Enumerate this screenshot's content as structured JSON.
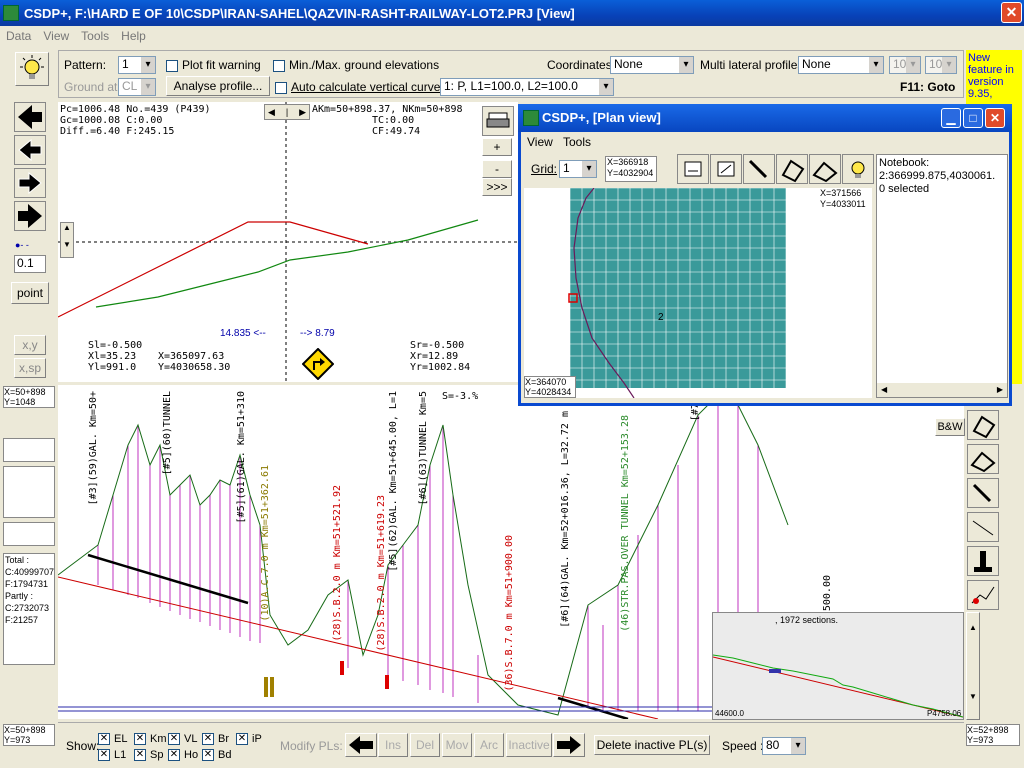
{
  "window": {
    "title": "CSDP+, F:\\HARD E OF 10\\CSDP\\IRAN-SAHEL\\QAZVIN-RASHT-RAILWAY-LOT2.PRJ [View]",
    "close": "✕"
  },
  "menu": [
    "Data",
    "View",
    "Tools",
    "Help"
  ],
  "toolbar": {
    "pattern_label": "Pattern:",
    "pattern_value": "1",
    "plot_fit": "Plot fit warning",
    "minmax": "Min./Max. ground elevations",
    "coords_label": "Coordinates:",
    "coords_value": "None",
    "multi_label": "Multi lateral profiles:",
    "multi_value": "None",
    "num1": "10",
    "num2": "10",
    "ground_label": "Ground at:",
    "ground_value": "CL",
    "analyse": "Analyse profile...",
    "auto_calc": "Auto calculate vertical curves",
    "curve_value": "1: P, L1=100.0, L2=100.0",
    "goto": "F11: Goto"
  },
  "news": "New feature in version 9.35,",
  "left_panel": {
    "zoom_value": "0.1",
    "point_btn": "point",
    "xy_btn": "x,y",
    "xsp_btn": "x,sp",
    "pos_top": "X=50+898",
    "pos_top2": "Y=1048",
    "totals": [
      "Total :",
      "C:40999707",
      "F:1794731",
      "Partly :",
      "C:2732073",
      "F:21257"
    ],
    "pos_bottom": "X=50+898",
    "pos_bottom2": "Y=973"
  },
  "profile_info": {
    "l1": "Pc=1006.48  No.=439 (P439)",
    "l2": "Gc=1000.08       C:0.00",
    "l3": "Diff.=6.40        F:245.15",
    "r1": "AKm=50+898.37, NKm=50+898",
    "r2": "TC:0.00",
    "r3": "CF:49.74",
    "sl": "Sl=-0.500",
    "xl": "Xl=35.23",
    "yl": "Yl=991.0",
    "mx": "X=365097.63",
    "my": "Y=4030658.30",
    "sr": "Sr=-0.500",
    "xr": "Xr=12.89",
    "yr": "Yr=1002.84",
    "dist_l": "14.835 <--",
    "dist_r": "--> 8.79"
  },
  "right_tools": {
    "plus": "+",
    "minus": "-",
    "more": ">>>",
    "bw": "B&W"
  },
  "plan": {
    "title": "CSDP+, [Plan view]",
    "menu": [
      "View",
      "Tools"
    ],
    "grid_label": "Grid:",
    "grid_value": "1",
    "coord_tl": "X=366918",
    "coord_tl2": "Y=4032904",
    "coord_tr": "X=371566",
    "coord_tr2": "Y=4033011",
    "coord_bl": "X=364070",
    "coord_bl2": "Y=4028434",
    "marker": "2",
    "notebook": "Notebook:",
    "nb_value": "2:366999.875,4030061.",
    "nb_sel": "0 selected"
  },
  "long": {
    "slope": "S=-3.%",
    "labels": [
      {
        "t": "[#3](59)GAL. Km=50+",
        "c": "#000"
      },
      {
        "t": "[#5](60)TUNNEL",
        "c": "#000"
      },
      {
        "t": "[#5](61)GAL. Km=51+310",
        "c": "#000"
      },
      {
        "t": "(10)A.C.7.0 m Km=51+362.61",
        "c": "#8a7a00"
      },
      {
        "t": "(28)S.B.2.0 m Km=51+521.92",
        "c": "#c00"
      },
      {
        "t": "(28)S.B.2.0 m Km=51+619.23",
        "c": "#c00"
      },
      {
        "t": "[#5](62)GAL. Km=51+645.00, L=1",
        "c": "#000"
      },
      {
        "t": "[#6](63)TUNNEL Km=5",
        "c": "#000"
      },
      {
        "t": "(36)S.B.7.0 m Km=51+900.00",
        "c": "#c00"
      },
      {
        "t": "[#6](64)GAL. Km=52+016.36, L=32.72 m",
        "c": "#000"
      },
      {
        "t": "(46)STR.PAS.OVER TUNNEL Km=52+153.28",
        "c": "#2a8a2a"
      },
      {
        "t": "[#7](",
        "c": "#000"
      },
      {
        "t": "500.00",
        "c": "#000"
      }
    ]
  },
  "minimap": {
    "sections": ", 1972 sections.",
    "left": "44600.0",
    "right": "P4758.06"
  },
  "pos_right": "X=52+898",
  "pos_right2": "Y=973",
  "bottom": {
    "show": "Show:",
    "checks": [
      "EL",
      "Km",
      "VL",
      "Br",
      "iP",
      "L1",
      "Sp",
      "Ho",
      "Bd"
    ],
    "modify": "Modify PLs:",
    "ins": "Ins",
    "del": "Del",
    "mov": "Mov",
    "arc": "Arc",
    "inactive": "Inactive",
    "delete_inactive": "Delete inactive PL(s)",
    "speed_label": "Speed :",
    "speed_value": "80"
  }
}
